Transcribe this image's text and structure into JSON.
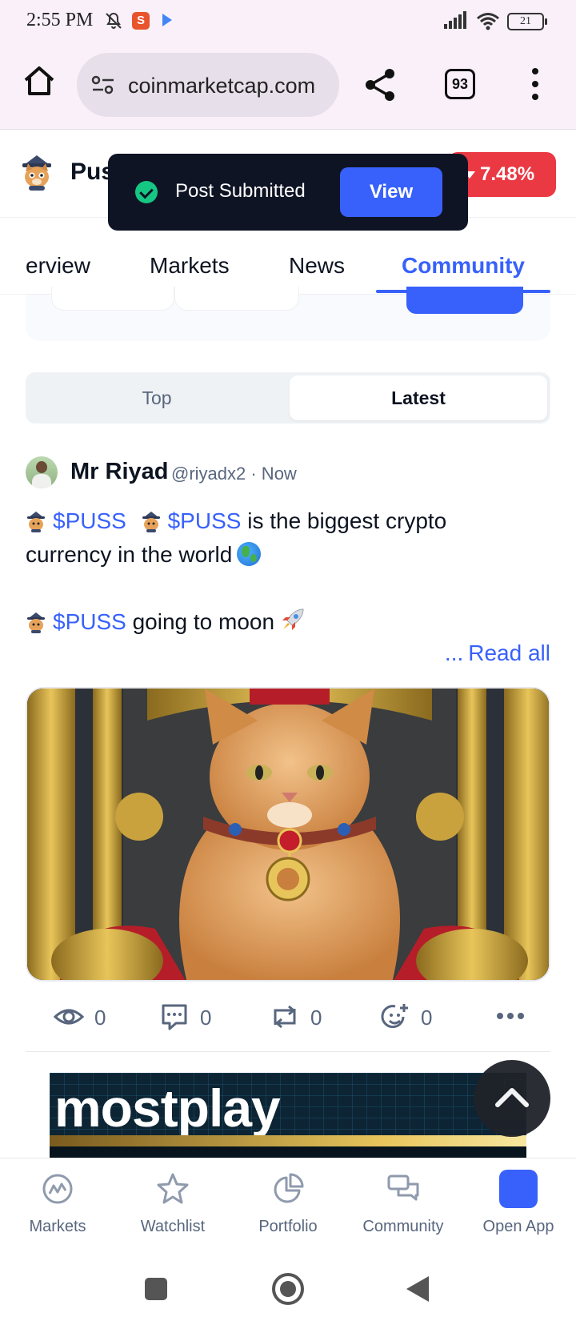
{
  "status_bar": {
    "time": "2:55 PM",
    "battery": "21"
  },
  "browser": {
    "url": "coinmarketcap.com",
    "tab_count": "93"
  },
  "coin_header": {
    "name": "Pus",
    "change": "7.48%",
    "change_color": "#ea3943"
  },
  "toast": {
    "message": "Post Submitted",
    "action_label": "View"
  },
  "tabs": [
    {
      "label": "erview"
    },
    {
      "label": "Markets"
    },
    {
      "label": "News"
    },
    {
      "label": "Community",
      "active": true
    }
  ],
  "feed_toggle": {
    "top_label": "Top",
    "latest_label": "Latest",
    "selected": "Latest"
  },
  "post": {
    "author": "Mr Riyad",
    "handle_time": "@riyadx2 · Now",
    "ticker": "$PUSS",
    "line1_suffix": " is the biggest crypto",
    "line2": "currency in the world",
    "line3_suffix": " going to moon",
    "read_all_dots": "...",
    "read_all": "Read all",
    "stats": {
      "views": "0",
      "comments": "0",
      "reposts": "0",
      "reactions": "0"
    }
  },
  "ad": {
    "brand": "mostplay"
  },
  "bottom_nav": [
    {
      "label": "Markets",
      "icon": "markets-icon"
    },
    {
      "label": "Watchlist",
      "icon": "star-icon"
    },
    {
      "label": "Portfolio",
      "icon": "pie-chart-icon"
    },
    {
      "label": "Community",
      "icon": "chat-bubbles-icon"
    },
    {
      "label": "Open App",
      "icon": "cmc-app-icon"
    }
  ],
  "colors": {
    "accent": "#3861fb",
    "negative": "#ea3943",
    "success": "#16c784",
    "text_primary": "#0d1421",
    "text_secondary": "#58667e"
  }
}
